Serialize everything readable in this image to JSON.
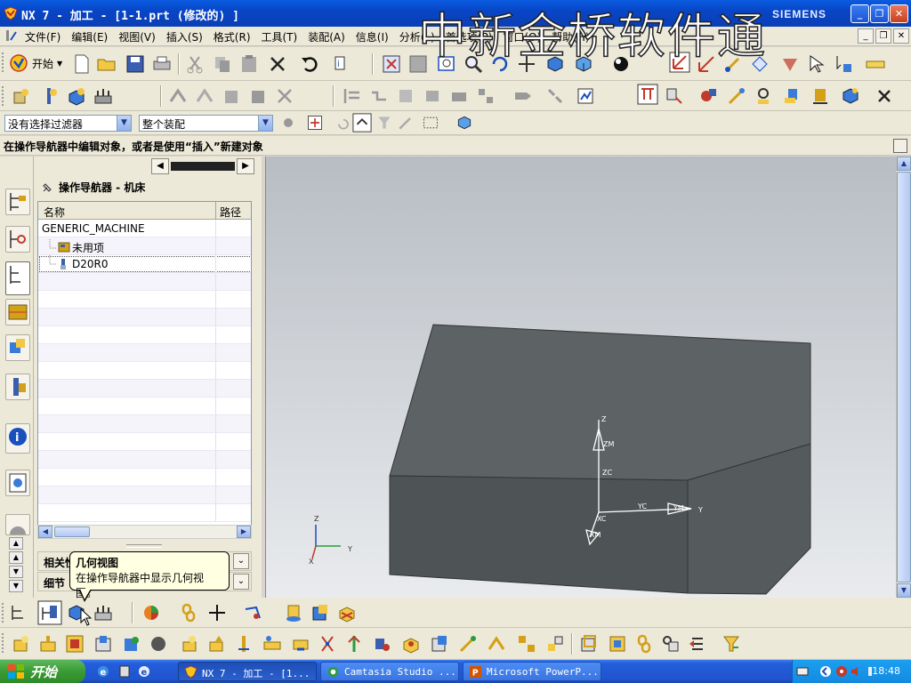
{
  "window": {
    "title": "NX 7 - 加工 - [1-1.prt (修改的) ]",
    "brand": "SIEMENS",
    "watermark": "中新金桥软件通"
  },
  "menubar": {
    "items": [
      "文件(F)",
      "编辑(E)",
      "视图(V)",
      "插入(S)",
      "格式(R)",
      "工具(T)",
      "装配(A)",
      "信息(I)",
      "分析(L)",
      "首选项(P)",
      "窗口(O)",
      "帮助(H)"
    ]
  },
  "toolbar": {
    "start_label": "开始",
    "filter_value": "没有选择过滤器",
    "scope_value": "整个装配"
  },
  "status": {
    "prompt": "在操作导航器中编辑对象，或者是使用“插入”新建对象"
  },
  "navigator": {
    "title": "操作导航器 - 机床",
    "columns": [
      "名称",
      "路径"
    ],
    "rows": [
      "GENERIC_MACHINE",
      "未用项",
      "D20R0"
    ],
    "sections": [
      "相关性",
      "细节"
    ]
  },
  "tooltip": {
    "title": "几何视图",
    "text": "在操作导航器中显示几何视图。"
  },
  "viewport": {
    "axis_labels": {
      "z": "Z",
      "zm": "ZM",
      "zc": "ZC",
      "xc": "XC",
      "yc": "YC",
      "ym": "YM",
      "y": "Y",
      "xm": "XM",
      "tz": "Z",
      "ty": "Y",
      "tx": "X"
    }
  },
  "taskbar": {
    "start_label": "开始",
    "tasks": [
      "NX 7 - 加工 - [1...",
      "Camtasia Studio ...",
      "Microsoft PowerP..."
    ],
    "clock": "18:48"
  },
  "colors": {
    "titlebar": "#0845c7",
    "block_top": "#5d6365",
    "block_front": "#4e5455",
    "block_side": "#555b5c",
    "viewport_bg_top": "#b8bdc3",
    "viewport_bg_bottom": "#e9ebee",
    "taskbar": "#245edb"
  }
}
